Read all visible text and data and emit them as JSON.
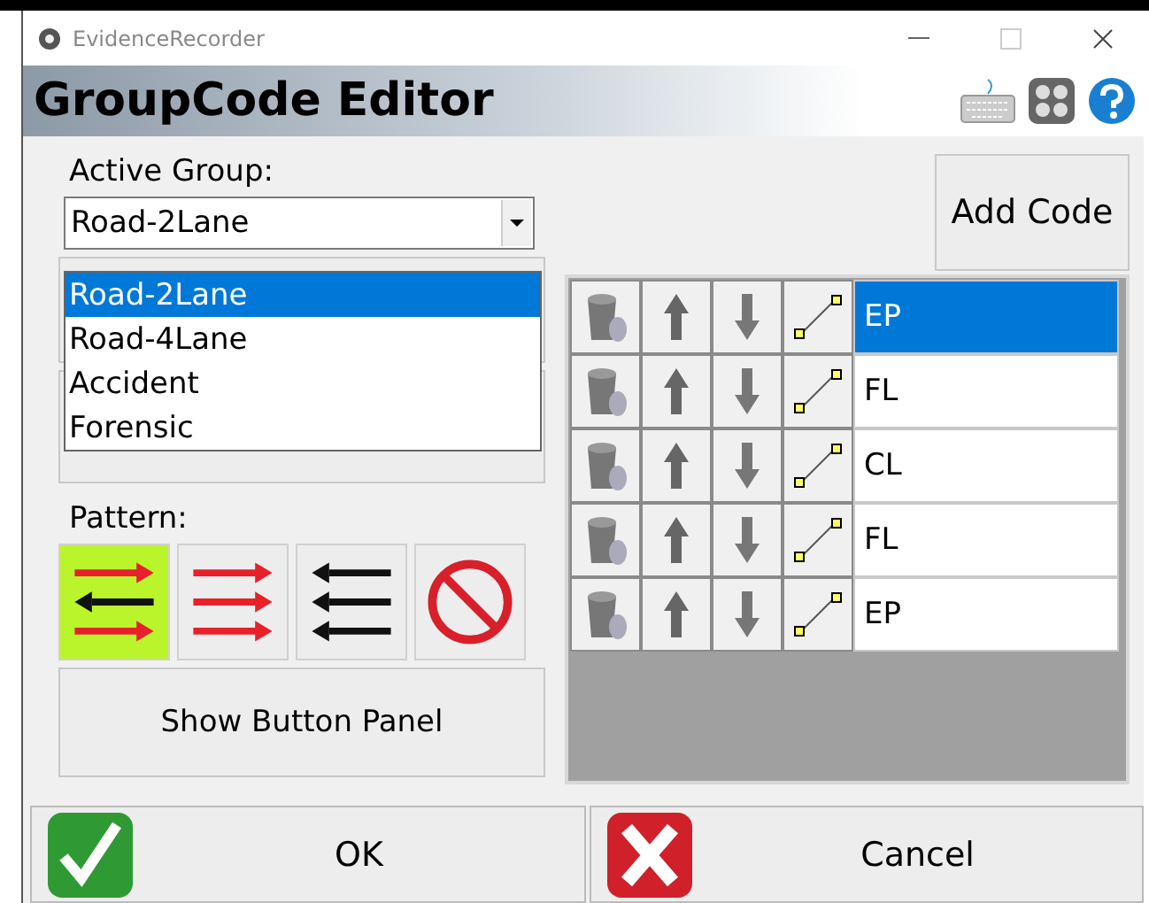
{
  "window": {
    "title": "EvidenceRecorder"
  },
  "header": {
    "title": "GroupCode Editor"
  },
  "active_group": {
    "label": "Active Group:",
    "value": "Road-2Lane",
    "options": [
      {
        "label": "Road-2Lane",
        "selected": true
      },
      {
        "label": "Road-4Lane",
        "selected": false
      },
      {
        "label": "Accident",
        "selected": false
      },
      {
        "label": "Forensic",
        "selected": false
      }
    ]
  },
  "pattern": {
    "label": "Pattern:",
    "options": [
      {
        "kind": "alternating",
        "selected": true
      },
      {
        "kind": "right",
        "selected": false
      },
      {
        "kind": "left",
        "selected": false
      },
      {
        "kind": "none",
        "selected": false
      }
    ]
  },
  "show_panel_button": "Show Button Panel",
  "add_code_button": "Add Code",
  "codes": [
    {
      "label": "EP",
      "selected": true
    },
    {
      "label": "FL",
      "selected": false
    },
    {
      "label": "CL",
      "selected": false
    },
    {
      "label": "FL",
      "selected": false
    },
    {
      "label": "EP",
      "selected": false
    }
  ],
  "ok_button": "OK",
  "cancel_button": "Cancel"
}
